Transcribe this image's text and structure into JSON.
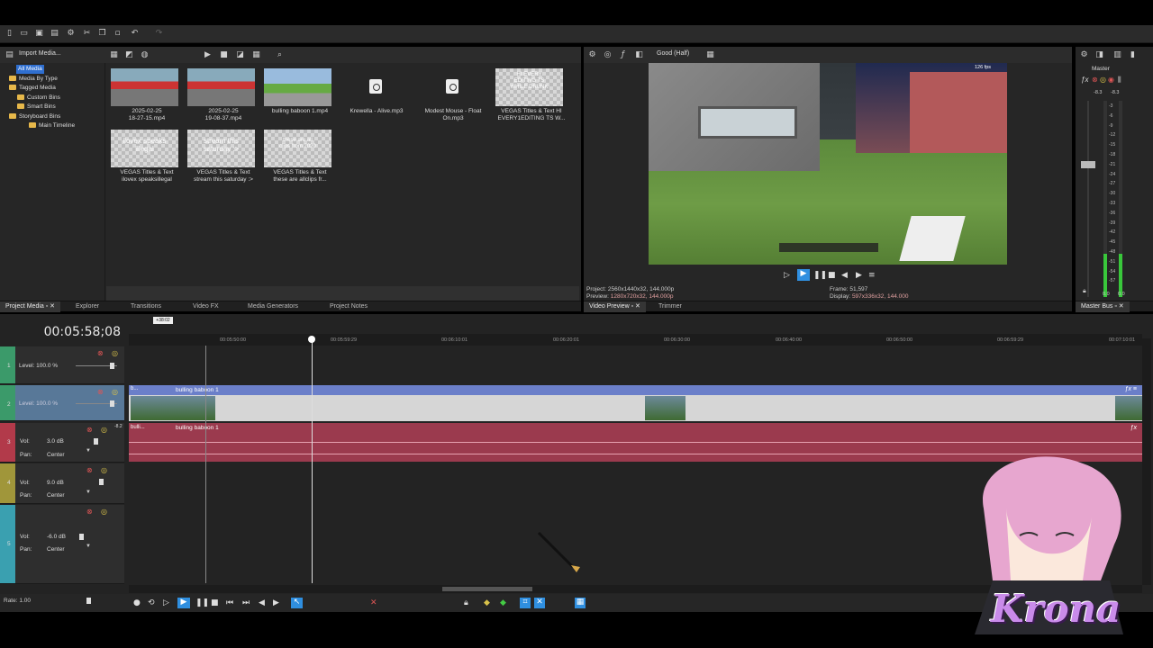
{
  "toolbar": {
    "icons": [
      "new-icon",
      "open-icon",
      "save-icon",
      "properties-icon",
      "settings-icon",
      "cut-icon",
      "copy-icon",
      "paste-icon",
      "undo-icon",
      "redo-icon"
    ]
  },
  "media_panel": {
    "import_label": "Import Media...",
    "tree": [
      "All Media",
      "Media By Type",
      "Tagged Media",
      "Custom Bins",
      "Smart Bins",
      "Storyboard Bins",
      "Main Timeline"
    ],
    "items": [
      {
        "label": "2025-02-25\n18-27-15.mp4",
        "kind": "race",
        "text": ""
      },
      {
        "label": "2025-02-25\n19-08-37.mp4",
        "kind": "race",
        "text": ""
      },
      {
        "label": "bulling baboon 1.mp4",
        "kind": "mc",
        "text": ""
      },
      {
        "label": "Krewella - Alive.mp3",
        "kind": "audio",
        "text": ""
      },
      {
        "label": "Modest Mouse - Float\nOn.mp3",
        "kind": "audio",
        "text": ""
      },
      {
        "label": "VEGAS Titles & Text HI\nEVERY1EDITING TS W...",
        "kind": "title",
        "text": "HI EVERY\nEDITING TS\nWHILE DRUNK"
      },
      {
        "label": "VEGAS Titles & Text\nilovex speaksillegal",
        "kind": "title",
        "text": "ilovex speaks\nillegal"
      },
      {
        "label": "VEGAS Titles & Text\nstream this saturday :>",
        "kind": "title",
        "text": "stream this\nsaturday :>"
      },
      {
        "label": "VEGAS Titles & Text\nthese are allclips fr...",
        "kind": "title",
        "text": "these are all\nclips from 2020"
      }
    ],
    "tabs": [
      "Project Media",
      "Explorer",
      "Transitions",
      "Video FX",
      "Media Generators",
      "Project Notes"
    ]
  },
  "preview": {
    "quality": "Good (Half)",
    "project_label": "Project:",
    "project_value": "2560x1440x32, 144.000p",
    "preview_label": "Preview:",
    "preview_value": "1280x720x32, 144.000p",
    "frame_label": "Frame:",
    "frame_value": "51,597",
    "display_label": "Display:",
    "display_value": "597x336x32, 144.000",
    "fps": "126 fps",
    "tabs": [
      "Video Preview",
      "Trimmer"
    ]
  },
  "master": {
    "title": "Master",
    "left_peak": "-8.3",
    "right_peak": "-8.3",
    "scale": [
      "3",
      "6",
      "9",
      "12",
      "15",
      "18",
      "21",
      "24",
      "27",
      "30",
      "33",
      "36",
      "39",
      "42",
      "45",
      "48",
      "51",
      "54",
      "57"
    ],
    "bottom_left": "0.0",
    "bottom_right": "0.0",
    "tab": "Master Bus"
  },
  "timeline": {
    "timecode": "00:05:58;08",
    "marker": "+38:02",
    "ticks": [
      "00:05:50:00",
      "00:05:59:29",
      "00:06:10:01",
      "00:06:20:01",
      "00:06:30:00",
      "00:06:40:00",
      "00:06:50:00",
      "00:06:59:29",
      "00:07:10:01"
    ],
    "tracks": [
      {
        "num": "1",
        "level_label": "Level:",
        "level_value": "100.0 %"
      },
      {
        "num": "2",
        "level_label": "Level:",
        "level_value": "100.0 %"
      },
      {
        "num": "3",
        "vol_label": "Vol:",
        "vol_value": "3.0 dB",
        "pan_label": "Pan:",
        "pan_value": "Center",
        "peak": "-8.2"
      },
      {
        "num": "4",
        "vol_label": "Vol:",
        "vol_value": "9.0 dB",
        "pan_label": "Pan:",
        "pan_value": "Center"
      },
      {
        "num": "5",
        "vol_label": "Vol:",
        "vol_value": "-6.0 dB",
        "pan_label": "Pan:",
        "pan_value": "Center"
      }
    ],
    "clip_video": "bulling baboon 1",
    "clip_audio": "bulling baboon 1",
    "clip_audio_short": "bulli...",
    "clip_video_short": "b...",
    "rate_label": "Rate:",
    "rate_value": "1.00"
  },
  "overlay": {
    "watermark": "Krona"
  },
  "colors": {
    "video_clip": "#6b7fc9",
    "audio_clip": "#9b3a4e",
    "meter": "#39c73b",
    "accent": "#2f8fe0"
  }
}
